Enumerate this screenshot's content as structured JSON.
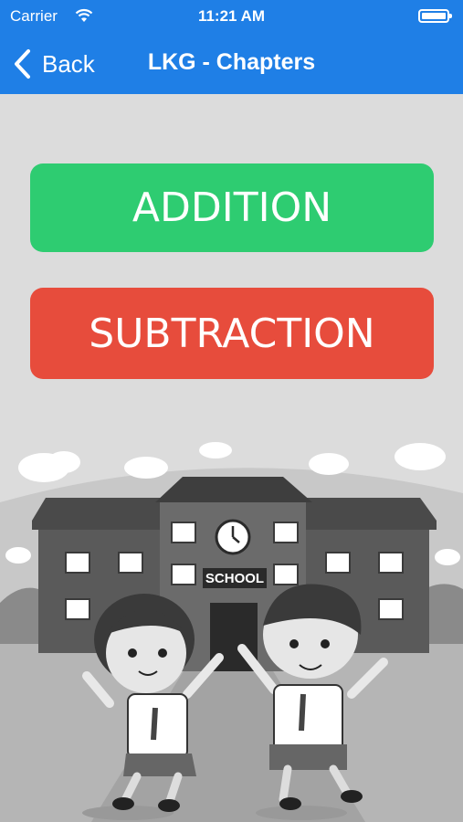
{
  "status_bar": {
    "carrier": "Carrier",
    "time": "11:21 AM"
  },
  "nav": {
    "back_label": "Back",
    "title": "LKG - Chapters"
  },
  "chapters": [
    {
      "label": "ADDITION",
      "color": "#2ecc71"
    },
    {
      "label": "SUBTRACTION",
      "color": "#e74c3c"
    }
  ],
  "illustration": {
    "sign_text": "SCHOOL"
  },
  "colors": {
    "nav_bar": "#1f7fe6",
    "background": "#dcdcdc"
  }
}
